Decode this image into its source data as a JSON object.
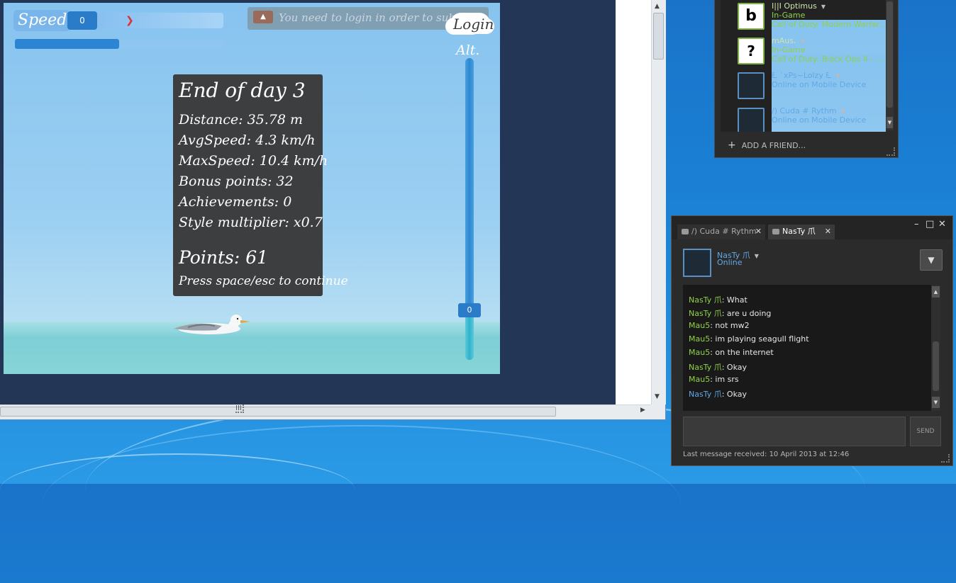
{
  "game": {
    "speed_label": "Speed",
    "speed_value": "0",
    "login_message": "You need to login in order to submit your",
    "login_button": "Login",
    "altitude_label": "Alt.",
    "altitude_value": "0",
    "progress_fraction": 0.5,
    "summary": {
      "title": "End of day 3",
      "distance": "Distance: 35.78 m",
      "avg_speed": "AvgSpeed: 4.3 km/h",
      "max_speed": "MaxSpeed: 10.4 km/h",
      "bonus": "Bonus points: 32",
      "achievements": "Achievements: 0",
      "style": "Style multiplier: x0.7",
      "points": "Points: 61",
      "hint": "Press space/esc to continue"
    }
  },
  "browser": {
    "hscroll_grip": "III"
  },
  "friends": {
    "items": [
      {
        "name": "I||I Optimus",
        "status": "In-Game",
        "game": "Call of Duty: Modern Warfare...",
        "avatar_glyph": "b"
      },
      {
        "name": "mAus.",
        "status": "In-Game",
        "game": "Call of Duty: Black Ops II - M...",
        "avatar_glyph": "?"
      },
      {
        "name": "ᘍ `xPs~Lolzy ᘍ",
        "status": "Online on Mobile Device"
      },
      {
        "name": "/) Cuda # Rythm",
        "status": "Online on Mobile Device"
      }
    ],
    "add_friend": "ADD A FRIEND..."
  },
  "chat": {
    "tabs": [
      "/) Cuda # Rythm",
      "NasTy 爪"
    ],
    "contact_name": "NasTy 爪",
    "contact_status": "Online",
    "messages": [
      {
        "who": "NasTy 爪",
        "text": "What",
        "color": "green"
      },
      {
        "who": "NasTy 爪",
        "text": "are u doing",
        "color": "green"
      },
      {
        "who": "Mau5",
        "text": "not mw2",
        "color": "green"
      },
      {
        "who": "Mau5",
        "text": "im playing seagull flight",
        "color": "green"
      },
      {
        "who": "Mau5",
        "text": "on the internet",
        "color": "green"
      },
      {
        "who": "NasTy 爪",
        "text": "Okay",
        "color": "green"
      },
      {
        "who": "Mau5",
        "text": "im srs",
        "color": "green"
      },
      {
        "who": "NasTy 爪",
        "text": "Okay",
        "color": "blue"
      }
    ],
    "send_label": "SEND",
    "last_message": "Last message received: 10 April 2013 at 12:46"
  },
  "colors": {
    "steam_green": "#8fd14a",
    "steam_blue": "#62a8e5",
    "panel_bg": "#3c3e40"
  }
}
